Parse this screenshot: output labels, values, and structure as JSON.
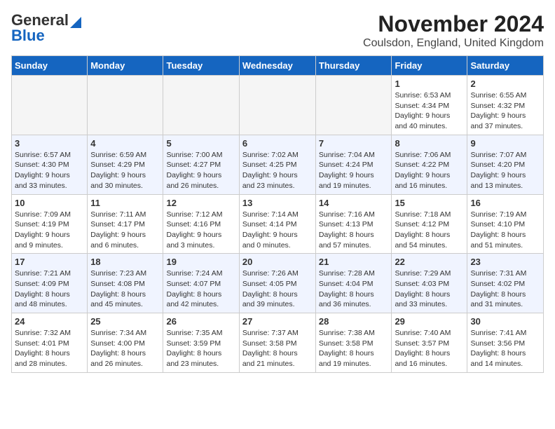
{
  "header": {
    "logo_general": "General",
    "logo_blue": "Blue",
    "month_title": "November 2024",
    "location": "Coulsdon, England, United Kingdom"
  },
  "days_of_week": [
    "Sunday",
    "Monday",
    "Tuesday",
    "Wednesday",
    "Thursday",
    "Friday",
    "Saturday"
  ],
  "weeks": [
    [
      {
        "day": "",
        "info": ""
      },
      {
        "day": "",
        "info": ""
      },
      {
        "day": "",
        "info": ""
      },
      {
        "day": "",
        "info": ""
      },
      {
        "day": "",
        "info": ""
      },
      {
        "day": "1",
        "info": "Sunrise: 6:53 AM\nSunset: 4:34 PM\nDaylight: 9 hours\nand 40 minutes."
      },
      {
        "day": "2",
        "info": "Sunrise: 6:55 AM\nSunset: 4:32 PM\nDaylight: 9 hours\nand 37 minutes."
      }
    ],
    [
      {
        "day": "3",
        "info": "Sunrise: 6:57 AM\nSunset: 4:30 PM\nDaylight: 9 hours\nand 33 minutes."
      },
      {
        "day": "4",
        "info": "Sunrise: 6:59 AM\nSunset: 4:29 PM\nDaylight: 9 hours\nand 30 minutes."
      },
      {
        "day": "5",
        "info": "Sunrise: 7:00 AM\nSunset: 4:27 PM\nDaylight: 9 hours\nand 26 minutes."
      },
      {
        "day": "6",
        "info": "Sunrise: 7:02 AM\nSunset: 4:25 PM\nDaylight: 9 hours\nand 23 minutes."
      },
      {
        "day": "7",
        "info": "Sunrise: 7:04 AM\nSunset: 4:24 PM\nDaylight: 9 hours\nand 19 minutes."
      },
      {
        "day": "8",
        "info": "Sunrise: 7:06 AM\nSunset: 4:22 PM\nDaylight: 9 hours\nand 16 minutes."
      },
      {
        "day": "9",
        "info": "Sunrise: 7:07 AM\nSunset: 4:20 PM\nDaylight: 9 hours\nand 13 minutes."
      }
    ],
    [
      {
        "day": "10",
        "info": "Sunrise: 7:09 AM\nSunset: 4:19 PM\nDaylight: 9 hours\nand 9 minutes."
      },
      {
        "day": "11",
        "info": "Sunrise: 7:11 AM\nSunset: 4:17 PM\nDaylight: 9 hours\nand 6 minutes."
      },
      {
        "day": "12",
        "info": "Sunrise: 7:12 AM\nSunset: 4:16 PM\nDaylight: 9 hours\nand 3 minutes."
      },
      {
        "day": "13",
        "info": "Sunrise: 7:14 AM\nSunset: 4:14 PM\nDaylight: 9 hours\nand 0 minutes."
      },
      {
        "day": "14",
        "info": "Sunrise: 7:16 AM\nSunset: 4:13 PM\nDaylight: 8 hours\nand 57 minutes."
      },
      {
        "day": "15",
        "info": "Sunrise: 7:18 AM\nSunset: 4:12 PM\nDaylight: 8 hours\nand 54 minutes."
      },
      {
        "day": "16",
        "info": "Sunrise: 7:19 AM\nSunset: 4:10 PM\nDaylight: 8 hours\nand 51 minutes."
      }
    ],
    [
      {
        "day": "17",
        "info": "Sunrise: 7:21 AM\nSunset: 4:09 PM\nDaylight: 8 hours\nand 48 minutes."
      },
      {
        "day": "18",
        "info": "Sunrise: 7:23 AM\nSunset: 4:08 PM\nDaylight: 8 hours\nand 45 minutes."
      },
      {
        "day": "19",
        "info": "Sunrise: 7:24 AM\nSunset: 4:07 PM\nDaylight: 8 hours\nand 42 minutes."
      },
      {
        "day": "20",
        "info": "Sunrise: 7:26 AM\nSunset: 4:05 PM\nDaylight: 8 hours\nand 39 minutes."
      },
      {
        "day": "21",
        "info": "Sunrise: 7:28 AM\nSunset: 4:04 PM\nDaylight: 8 hours\nand 36 minutes."
      },
      {
        "day": "22",
        "info": "Sunrise: 7:29 AM\nSunset: 4:03 PM\nDaylight: 8 hours\nand 33 minutes."
      },
      {
        "day": "23",
        "info": "Sunrise: 7:31 AM\nSunset: 4:02 PM\nDaylight: 8 hours\nand 31 minutes."
      }
    ],
    [
      {
        "day": "24",
        "info": "Sunrise: 7:32 AM\nSunset: 4:01 PM\nDaylight: 8 hours\nand 28 minutes."
      },
      {
        "day": "25",
        "info": "Sunrise: 7:34 AM\nSunset: 4:00 PM\nDaylight: 8 hours\nand 26 minutes."
      },
      {
        "day": "26",
        "info": "Sunrise: 7:35 AM\nSunset: 3:59 PM\nDaylight: 8 hours\nand 23 minutes."
      },
      {
        "day": "27",
        "info": "Sunrise: 7:37 AM\nSunset: 3:58 PM\nDaylight: 8 hours\nand 21 minutes."
      },
      {
        "day": "28",
        "info": "Sunrise: 7:38 AM\nSunset: 3:58 PM\nDaylight: 8 hours\nand 19 minutes."
      },
      {
        "day": "29",
        "info": "Sunrise: 7:40 AM\nSunset: 3:57 PM\nDaylight: 8 hours\nand 16 minutes."
      },
      {
        "day": "30",
        "info": "Sunrise: 7:41 AM\nSunset: 3:56 PM\nDaylight: 8 hours\nand 14 minutes."
      }
    ]
  ]
}
